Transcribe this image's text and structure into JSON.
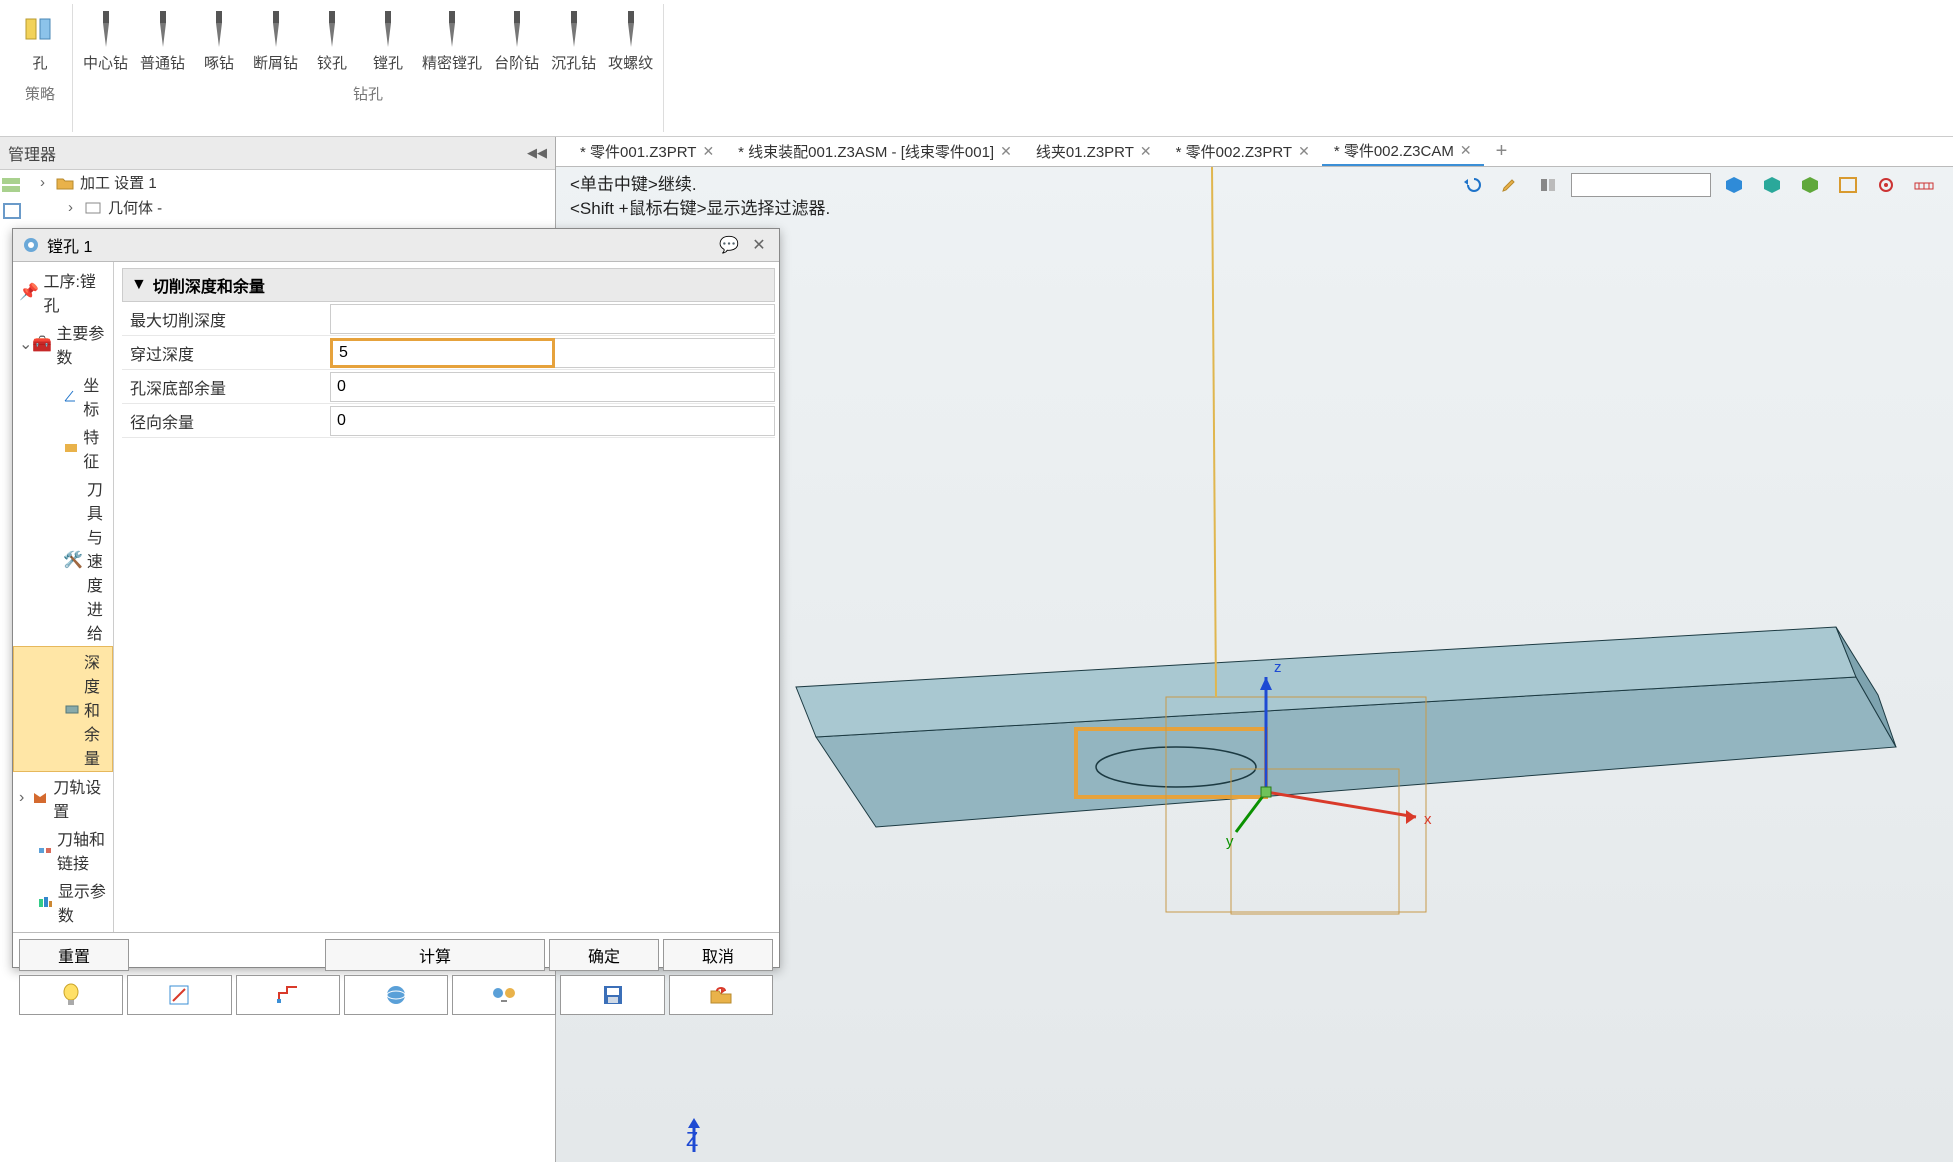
{
  "ribbon": {
    "group1_label": "策略",
    "group2_label": "钻孔",
    "items": [
      {
        "label": "孔"
      },
      {
        "label": "中心钻"
      },
      {
        "label": "普通钻"
      },
      {
        "label": "啄钻"
      },
      {
        "label": "断屑钻"
      },
      {
        "label": "铰孔"
      },
      {
        "label": "镗孔"
      },
      {
        "label": "精密镗孔"
      },
      {
        "label": "台阶钻"
      },
      {
        "label": "沉孔钻"
      },
      {
        "label": "攻螺纹"
      }
    ]
  },
  "manager": {
    "title": "管理器",
    "item1": "加工 设置 1",
    "item2": "几何体 -"
  },
  "dialog": {
    "title": "镗孔 1",
    "nodes": {
      "process": "工序:镗孔",
      "main": "主要参数",
      "coord": "坐标",
      "feature": "特征",
      "toolspeed": "刀具与速度进给",
      "depth": "深度和余量",
      "toolpath": "刀轨设置",
      "axislink": "刀轴和链接",
      "display": "显示参数"
    },
    "panel_title": "切削深度和余量",
    "fields": {
      "max_depth_label": "最大切削深度",
      "max_depth": "",
      "pass_depth_label": "穿过深度",
      "pass_depth": "5",
      "bottom_allow_label": "孔深底部余量",
      "bottom_allow": "0",
      "radial_allow_label": "径向余量",
      "radial_allow": "0"
    },
    "buttons": {
      "reset": "重置",
      "compute": "计算",
      "ok": "确定",
      "cancel": "取消"
    }
  },
  "tabs": [
    {
      "label": "* 零件001.Z3PRT",
      "closable": true,
      "active": false
    },
    {
      "label": "* 线束装配001.Z3ASM - [线束零件001]",
      "closable": true,
      "active": false
    },
    {
      "label": "线夹01.Z3PRT",
      "closable": true,
      "active": false
    },
    {
      "label": "* 零件002.Z3PRT",
      "closable": true,
      "active": false
    },
    {
      "label": "* 零件002.Z3CAM",
      "closable": true,
      "active": true
    }
  ],
  "viewport": {
    "hint1": "<单击中键>继续.",
    "hint2": "<Shift +鼠标右键>显示选择过滤器.",
    "axes": {
      "x": "x",
      "y": "y",
      "z": "z"
    },
    "mini_axis": "Z"
  },
  "colors": {
    "accent": "#3b8fd6",
    "highlight_border": "#e6a23c",
    "highlight_fill": "#ffe6a6",
    "part_fill": "#93b5c0",
    "axis_x": "#d93a2a",
    "axis_y": "#0a9100",
    "axis_z": "#1e4ad3"
  }
}
